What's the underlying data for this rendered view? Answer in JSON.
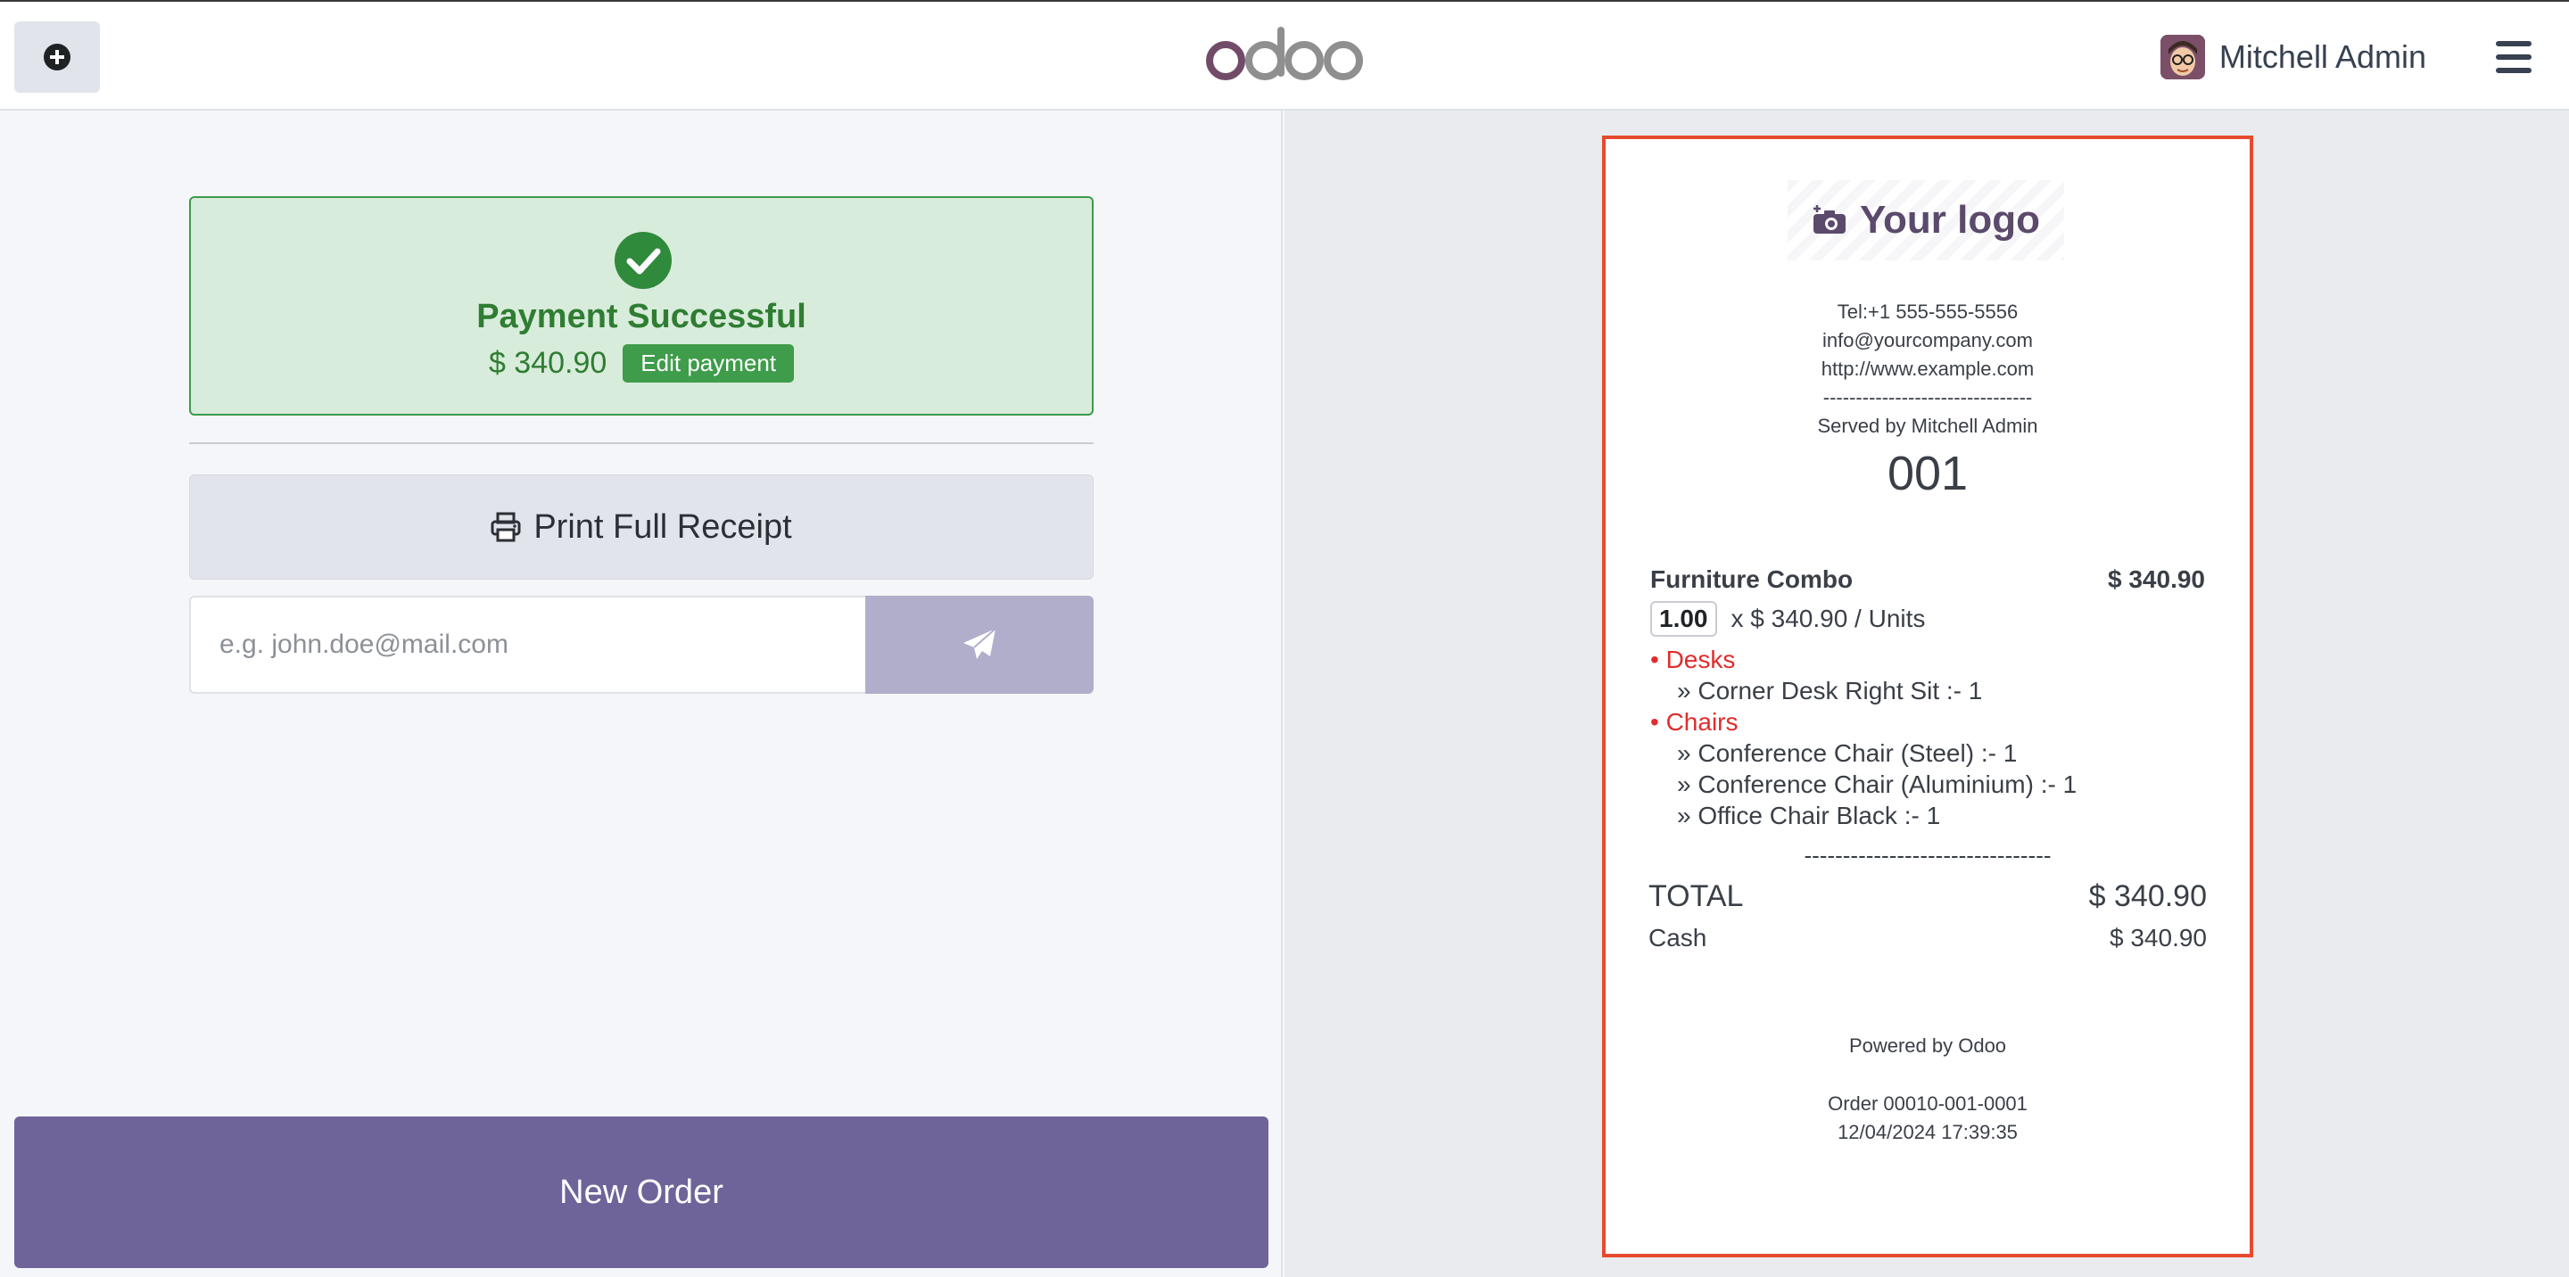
{
  "header": {
    "brand": "odoo",
    "user_name": "Mitchell Admin"
  },
  "payment": {
    "status_title": "Payment Successful",
    "amount": "$ 340.90",
    "edit_label": "Edit payment"
  },
  "actions": {
    "print_label": "Print Full Receipt",
    "email_placeholder": "e.g. john.doe@mail.com",
    "new_order_label": "New Order"
  },
  "receipt": {
    "logo_text": "Your logo",
    "phone": "Tel:+1 555-555-5556",
    "email": "info@yourcompany.com",
    "website": "http://www.example.com",
    "separator": "--------------------------------",
    "served_by": "Served by Mitchell Admin",
    "order_number": "001",
    "line": {
      "product": "Furniture Combo",
      "price": "$ 340.90",
      "qty": "1.00",
      "unit_text": "x $ 340.90 / Units"
    },
    "combo": [
      {
        "category": "• Desks",
        "items": [
          "» Corner Desk Right Sit :- 1"
        ]
      },
      {
        "category": "• Chairs",
        "items": [
          "» Conference Chair (Steel) :- 1",
          "» Conference Chair (Aluminium) :- 1",
          "» Office Chair Black :- 1"
        ]
      }
    ],
    "total_separator": "--------------------------------",
    "total_label": "TOTAL",
    "total_amount": "$ 340.90",
    "cash_label": "Cash",
    "cash_amount": "$ 340.90",
    "powered_by": "Powered by Odoo",
    "order_ref": "Order 00010-001-0001",
    "datetime": "12/04/2024 17:39:35"
  },
  "colors": {
    "accent": "#6e6499",
    "success": "#3e9c4a",
    "highlight_border": "#e64a2e",
    "combo_category": "#e02c2c"
  }
}
